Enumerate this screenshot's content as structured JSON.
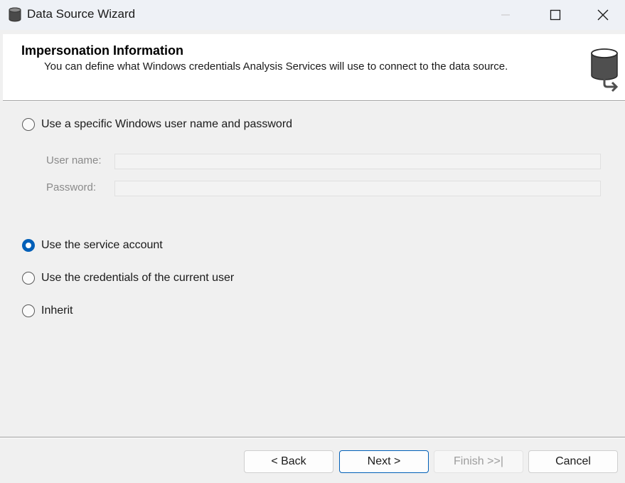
{
  "window": {
    "title": "Data Source Wizard",
    "icon": "database-icon",
    "controls": [
      "minimize-icon",
      "maximize-icon",
      "close-icon"
    ]
  },
  "header": {
    "title": "Impersonation Information",
    "description": "You can define what Windows credentials Analysis Services will use to connect to the data source.",
    "icon": "database-arrow-icon"
  },
  "options": {
    "specific_user": {
      "label": "Use a specific Windows user name and password",
      "checked": false
    },
    "service_account": {
      "label": "Use the service account",
      "checked": true
    },
    "current_user": {
      "label": "Use the credentials of the current user",
      "checked": false
    },
    "inherit": {
      "label": "Inherit",
      "checked": false
    }
  },
  "credentials": {
    "username_label": "User name:",
    "username_value": "",
    "password_label": "Password:",
    "password_value": "",
    "enabled": false
  },
  "buttons": {
    "back": "< Back",
    "next": "Next >",
    "finish": "Finish >>|",
    "cancel": "Cancel"
  },
  "colors": {
    "accent": "#005fb8",
    "disabled_text": "#8a8a8a"
  }
}
